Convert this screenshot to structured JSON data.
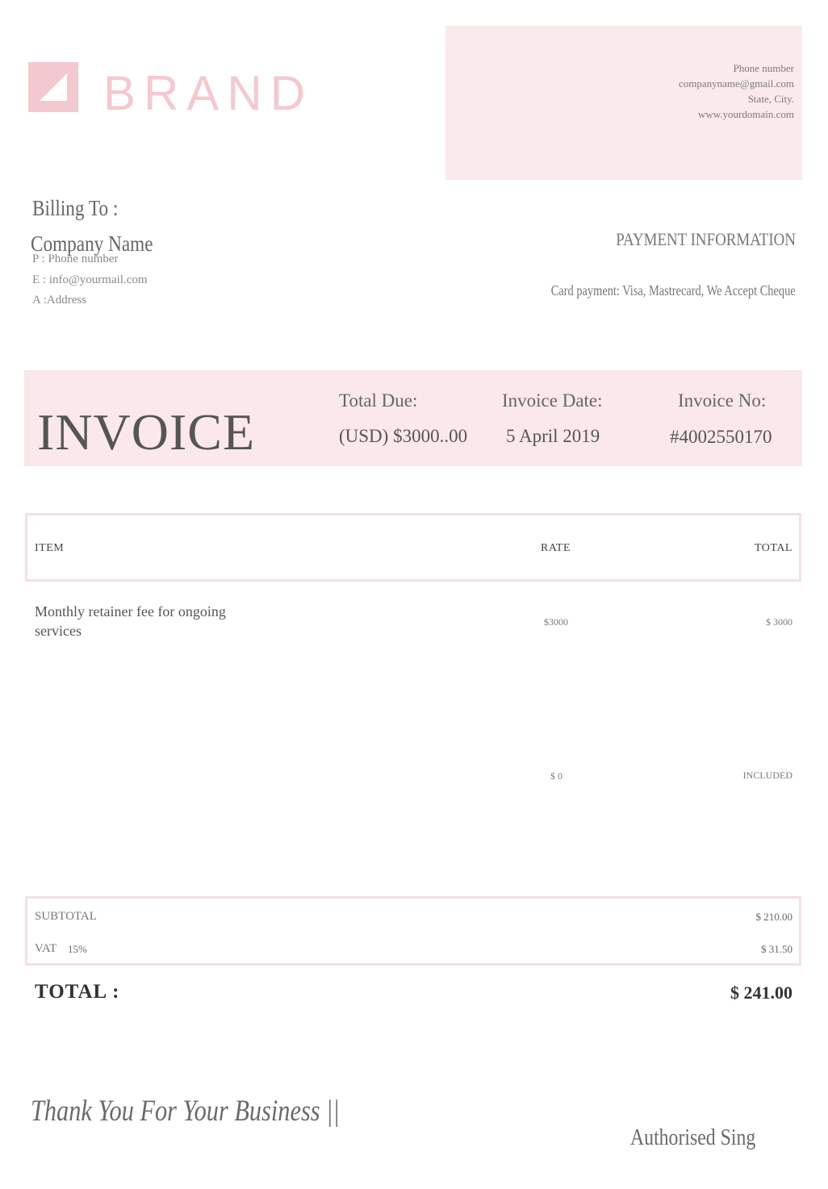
{
  "brand": {
    "name": "BRAND",
    "logo_icon": "corner-triangle-logo-icon",
    "accent_color": "#f3c9cf",
    "panel_color": "#fbeaec"
  },
  "contact": {
    "phone": "Phone number",
    "email": "companyname@gmail.com",
    "location": "State, City.",
    "website": "www.yourdomain.com"
  },
  "billing": {
    "title": "Billing To :",
    "company": "Company Name",
    "phone": "P : Phone number",
    "email": "E : info@yourmail.com",
    "address": "A :Address"
  },
  "payment": {
    "title": "PAYMENT INFORMATION",
    "detail": "Card payment: Visa, Mastrecard, We Accept Cheque"
  },
  "invoice": {
    "heading": "INVOICE",
    "total_due_label": "Total Due:",
    "total_due_value": "(USD) $3000..00",
    "date_label": "Invoice Date:",
    "date_value": "5 April 2019",
    "number_label": "Invoice No:",
    "number_value": "#4002550170"
  },
  "table": {
    "headers": {
      "item": "ITEM",
      "rate": "RATE",
      "total": "TOTAL"
    },
    "rows": [
      {
        "item": "Monthly retainer fee for ongoing services",
        "rate": "$3000",
        "total": "$ 3000"
      },
      {
        "item": "",
        "rate": "$ 0",
        "total": "INCLUDED"
      }
    ]
  },
  "summary": {
    "subtotal_label": "SUBTOTAL",
    "subtotal_value": "$ 210.00",
    "vat_label": "VAT",
    "vat_rate": "15%",
    "vat_value": "$ 31.50",
    "total_label": "TOTAL :",
    "total_value": "$ 241.00"
  },
  "footer": {
    "thanks": "Thank You For Your Business ||",
    "signature": "Authorised Sing"
  }
}
